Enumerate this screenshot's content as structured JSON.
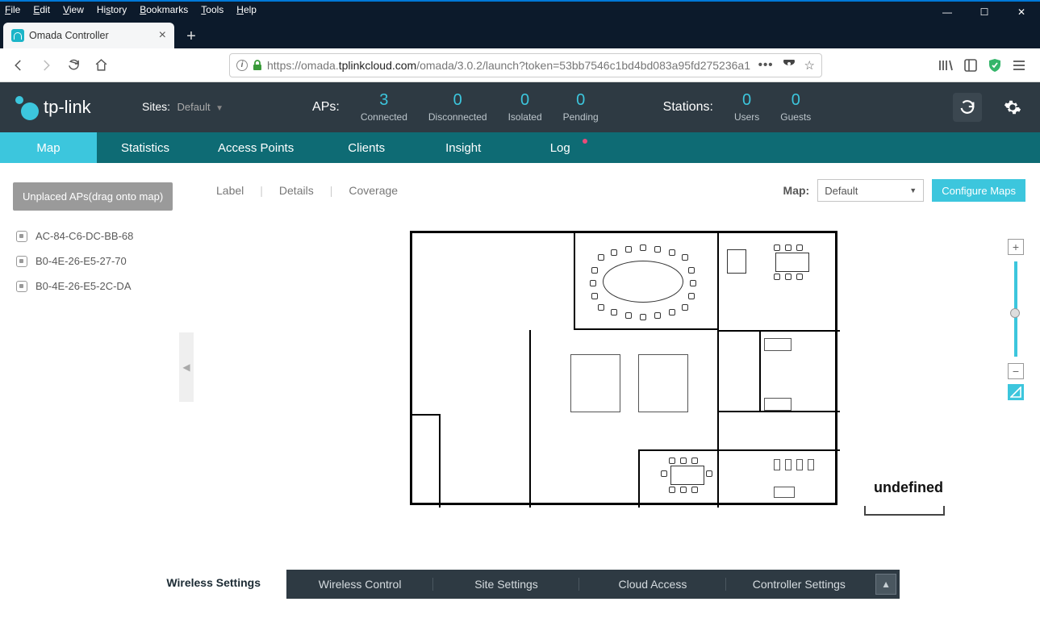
{
  "browser": {
    "menus": [
      "File",
      "Edit",
      "View",
      "History",
      "Bookmarks",
      "Tools",
      "Help"
    ],
    "tab_title": "Omada Controller",
    "url_prefix": "https://omada.",
    "url_domain": "tplinkcloud.com",
    "url_rest": "/omada/3.0.2/launch?token=53bb7546c1bd4bd083a95fd275236a1"
  },
  "header": {
    "brand": "tp-link",
    "sites_label": "Sites:",
    "sites_value": "Default",
    "aps_label": "APs:",
    "stations_label": "Stations:",
    "stats_aps": [
      {
        "num": "3",
        "sub": "Connected"
      },
      {
        "num": "0",
        "sub": "Disconnected"
      },
      {
        "num": "0",
        "sub": "Isolated"
      },
      {
        "num": "0",
        "sub": "Pending"
      }
    ],
    "stats_stations": [
      {
        "num": "0",
        "sub": "Users"
      },
      {
        "num": "0",
        "sub": "Guests"
      }
    ]
  },
  "nav": {
    "items": [
      "Map",
      "Statistics",
      "Access Points",
      "Clients",
      "Insight",
      "Log"
    ],
    "active": 0,
    "badge_on": 5
  },
  "sidebar": {
    "unplaced_label": "Unplaced APs(drag onto map)",
    "aps": [
      "AC-84-C6-DC-BB-68",
      "B0-4E-26-E5-27-70",
      "B0-4E-26-E5-2C-DA"
    ]
  },
  "toolbar": {
    "views": [
      "Label",
      "Details",
      "Coverage"
    ],
    "map_label": "Map:",
    "map_selected": "Default",
    "configure_label": "Configure Maps"
  },
  "canvas": {
    "overlay_text": "undefined"
  },
  "footer": {
    "tabs": [
      "Wireless Settings",
      "Wireless Control",
      "Site Settings",
      "Cloud Access",
      "Controller Settings"
    ],
    "active": 0
  }
}
